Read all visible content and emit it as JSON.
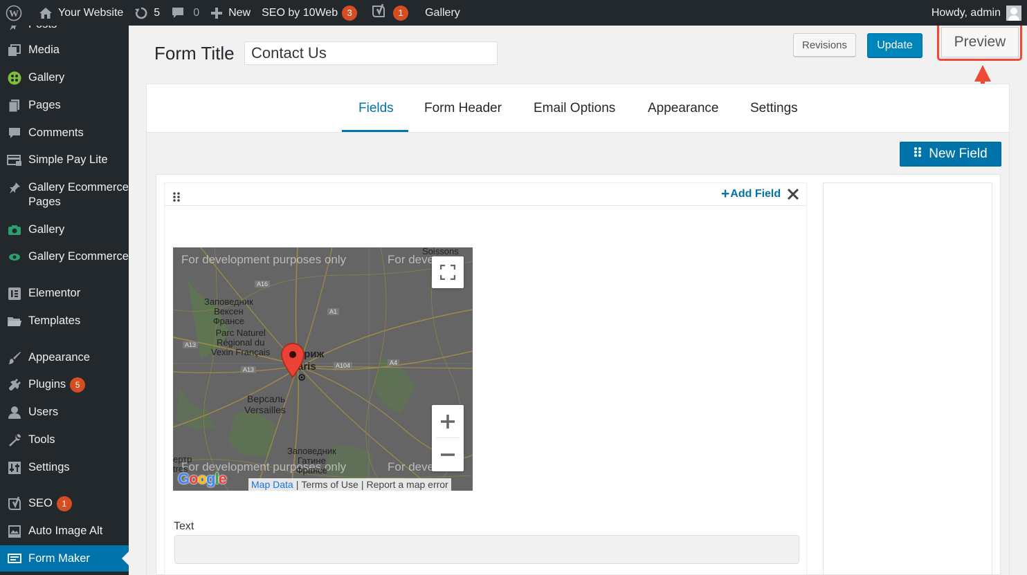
{
  "adminbar": {
    "site_name": "Your Website",
    "updates_count": "5",
    "comments_count": "0",
    "new_label": "New",
    "seo_label": "SEO by 10Web",
    "seo_badge": "3",
    "yoast_badge": "1",
    "gallery_label": "Gallery",
    "howdy": "Howdy, admin"
  },
  "sidebar": {
    "items": [
      {
        "label": "Posts",
        "icon": "pin-icon"
      },
      {
        "label": "Media",
        "icon": "media-icon"
      },
      {
        "label": "Gallery",
        "icon": "gallery-green-icon"
      },
      {
        "label": "Pages",
        "icon": "pages-icon"
      },
      {
        "label": "Comments",
        "icon": "comment-icon"
      },
      {
        "label": "Simple Pay Lite",
        "icon": "simple-pay-icon"
      },
      {
        "label": "Gallery Ecommerce Pages",
        "icon": "pushpin-icon"
      },
      {
        "label": "Gallery",
        "icon": "camera-icon"
      },
      {
        "label": "Gallery Ecommerce",
        "icon": "ecommerce-icon"
      },
      {
        "label": "Elementor",
        "icon": "elementor-icon"
      },
      {
        "label": "Templates",
        "icon": "folder-icon"
      },
      {
        "label": "Appearance",
        "icon": "brush-icon"
      },
      {
        "label": "Plugins",
        "icon": "plug-icon",
        "badge": "5"
      },
      {
        "label": "Users",
        "icon": "user-icon"
      },
      {
        "label": "Tools",
        "icon": "wrench-icon"
      },
      {
        "label": "Settings",
        "icon": "sliders-icon"
      },
      {
        "label": "SEO",
        "icon": "yoast-icon",
        "badge": "1"
      },
      {
        "label": "Auto Image Alt",
        "icon": "image-alt-icon"
      },
      {
        "label": "Form Maker",
        "icon": "form-maker-icon",
        "active": true
      }
    ]
  },
  "header": {
    "form_title_label": "Form Title",
    "form_title_value": "Contact Us",
    "revisions_label": "Revisions",
    "update_label": "Update",
    "preview_label": "Preview"
  },
  "tabs": [
    {
      "label": "Fields",
      "active": true
    },
    {
      "label": "Form Header"
    },
    {
      "label": "Email Options"
    },
    {
      "label": "Appearance"
    },
    {
      "label": "Settings"
    }
  ],
  "builder": {
    "new_field_label": "New Field",
    "add_field_label": "Add Field",
    "text_field_label": "Text"
  },
  "map": {
    "dev_text": "For development purposes only",
    "dev_text_partial": "For deve",
    "labels": {
      "soissons": "Soissons",
      "reserve1": "Заповедник\nВексен\nФрансе",
      "parc": "Parc Naturel\nRégional du\nVexin Français",
      "paris_ru": "Париж",
      "paris": "Paris",
      "versailles_ru": "Версаль",
      "versailles": "Versailles",
      "reserve2": "Заповедник\nГатине\nФрансе",
      "ertr": "ертр\ntres"
    },
    "shields": [
      "A16",
      "A1",
      "A13",
      "A13",
      "A104",
      "A4"
    ],
    "google": "Google",
    "attribution": {
      "map_data": "Map Data",
      "terms": "Terms of Use",
      "report": "Report a map error"
    }
  },
  "colors": {
    "wp_dark": "#23282d",
    "wp_blue": "#0073aa",
    "highlight_red": "#ef4836",
    "badge_orange": "#d54e21"
  }
}
